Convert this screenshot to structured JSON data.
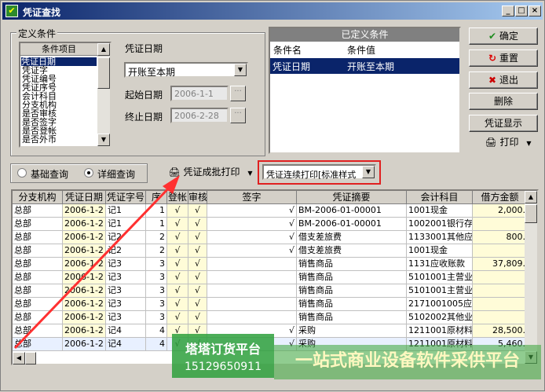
{
  "window": {
    "title": "凭证查找",
    "buttons": [
      "_",
      "□",
      "×"
    ]
  },
  "conditions": {
    "group_label": "定义条件",
    "list_header": "条件项目",
    "items": [
      "凭证日期",
      "凭证字",
      "凭证编号",
      "凭证序号",
      "会计科目",
      "分支机构",
      "是否审核",
      "是否签字",
      "是否登帐",
      "是否外币"
    ],
    "date_label": "凭证日期",
    "date_option": "开账至本期",
    "start_label": "起始日期",
    "start_value": "2006-1-1",
    "end_label": "终止日期",
    "end_value": "2006-2-28",
    "ellipsis": "···"
  },
  "defined": {
    "title": "已定义条件",
    "col_name": "条件名",
    "col_value": "条件值",
    "row_name": "凭证日期",
    "row_value": "开账至本期"
  },
  "actions": {
    "ok": "确定",
    "reset": "重置",
    "exit": "退出",
    "delete": "删除",
    "show": "凭证显示",
    "print": "打印"
  },
  "query": {
    "basic": "基础查询",
    "detail": "详细查询",
    "batch_print": "凭证成批打印",
    "continuous_print": "凭证连续打印[标准样式"
  },
  "grid": {
    "headers": [
      "分支机构",
      "凭证日期",
      "凭证字号",
      "序",
      "登帐",
      "审核",
      "签字",
      "凭证摘要",
      "会计科目",
      "借方金额"
    ],
    "rows": [
      [
        "总部",
        "2006-1-2",
        "记1",
        "1",
        "√",
        "√",
        "√",
        "BM-2006-01-00001",
        "1001现金",
        "2,000."
      ],
      [
        "总部",
        "2006-1-2",
        "记1",
        "1",
        "√",
        "√",
        "√",
        "BM-2006-01-00001",
        "1002001银行存",
        ""
      ],
      [
        "总部",
        "2006-1-2",
        "记2",
        "2",
        "√",
        "√",
        "√",
        "借支差旅费",
        "1133001其他应",
        "800."
      ],
      [
        "总部",
        "2006-1-2",
        "记2",
        "2",
        "√",
        "√",
        "√",
        "借支差旅费",
        "1001现金",
        ""
      ],
      [
        "总部",
        "2006-1-2",
        "记3",
        "3",
        "√",
        "√",
        "",
        "销售商品",
        "1131应收账款",
        "37,809."
      ],
      [
        "总部",
        "2006-1-2",
        "记3",
        "3",
        "√",
        "√",
        "",
        "销售商品",
        "5101001主营业",
        ""
      ],
      [
        "总部",
        "2006-1-2",
        "记3",
        "3",
        "√",
        "√",
        "",
        "销售商品",
        "5101001主营业",
        ""
      ],
      [
        "总部",
        "2006-1-2",
        "记3",
        "3",
        "√",
        "√",
        "",
        "销售商品",
        "2171001005应交",
        ""
      ],
      [
        "总部",
        "2006-1-2",
        "记3",
        "3",
        "√",
        "√",
        "",
        "销售商品",
        "5102002其他业",
        ""
      ],
      [
        "总部",
        "2006-1-2",
        "记4",
        "4",
        "√",
        "√",
        "√",
        "采购",
        "1211001原材料",
        "28,500."
      ],
      [
        "总部",
        "2006-1-2",
        "记4",
        "4",
        "√",
        "√",
        "√",
        "采购",
        "1211001原材料",
        "5,460."
      ]
    ]
  },
  "watermark": {
    "brand": "塔塔订货平台",
    "phone": "15129650911",
    "slogan": "一站式商业设备软件采供平台"
  }
}
